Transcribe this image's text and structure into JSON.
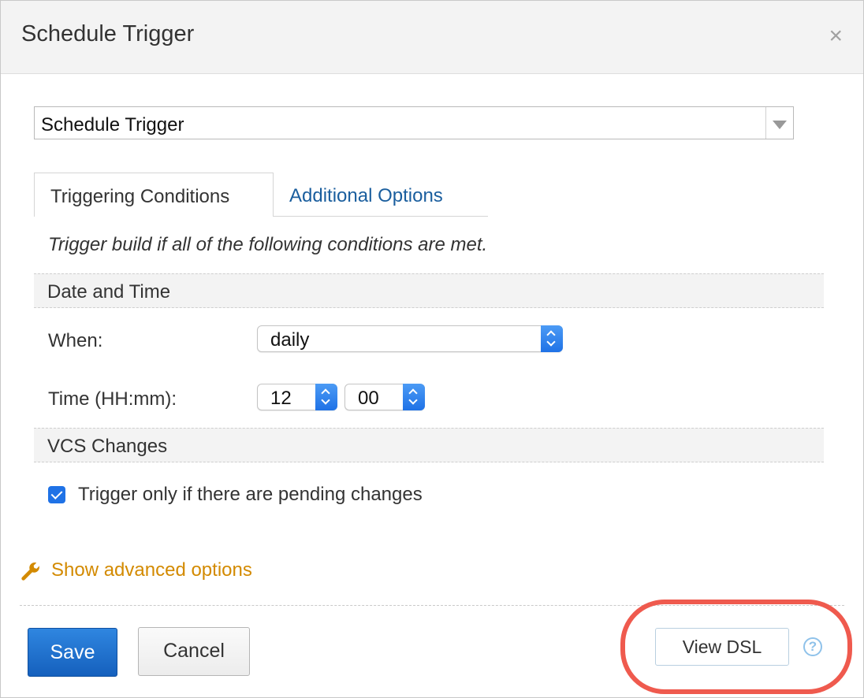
{
  "dialog": {
    "title": "Schedule Trigger",
    "close_label": "×"
  },
  "trigger_type": {
    "value": "Schedule Trigger"
  },
  "tabs": [
    {
      "label": "Triggering Conditions",
      "active": true
    },
    {
      "label": "Additional Options",
      "active": false
    }
  ],
  "hint": "Trigger build if all of the following conditions are met.",
  "sections": {
    "date_time": {
      "label": "Date and Time",
      "when_label": "When:",
      "when_value": "daily",
      "time_label": "Time (HH:mm):",
      "hour_value": "12",
      "minute_value": "00"
    },
    "vcs": {
      "label": "VCS Changes",
      "checkbox_label": "Trigger only if there are pending changes",
      "checked": true
    }
  },
  "advanced": {
    "label": "Show advanced options",
    "icon": "wrench-icon"
  },
  "footer": {
    "save_label": "Save",
    "cancel_label": "Cancel",
    "view_dsl_label": "View DSL",
    "help_label": "?"
  },
  "colors": {
    "primary_button": "#1f6fd0",
    "link": "#1a5e9e",
    "advanced_link": "#d38a00",
    "highlight": "#ef5a4e",
    "checkbox": "#1f72e6"
  }
}
